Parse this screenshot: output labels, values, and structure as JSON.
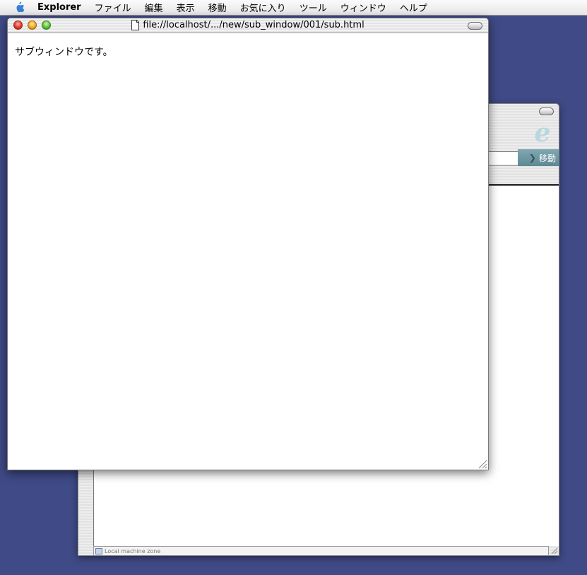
{
  "menubar": {
    "app_name": "Explorer",
    "items": [
      "ファイル",
      "編集",
      "表示",
      "移動",
      "お気に入り",
      "ツール",
      "ウィンドウ",
      "ヘルプ"
    ]
  },
  "front_window": {
    "title": "file://localhost/.../new/sub_window/001/sub.html",
    "body_text": "サブウィンドウです。"
  },
  "back_window": {
    "go_label": "移動",
    "status_text": "Local machine zone"
  }
}
